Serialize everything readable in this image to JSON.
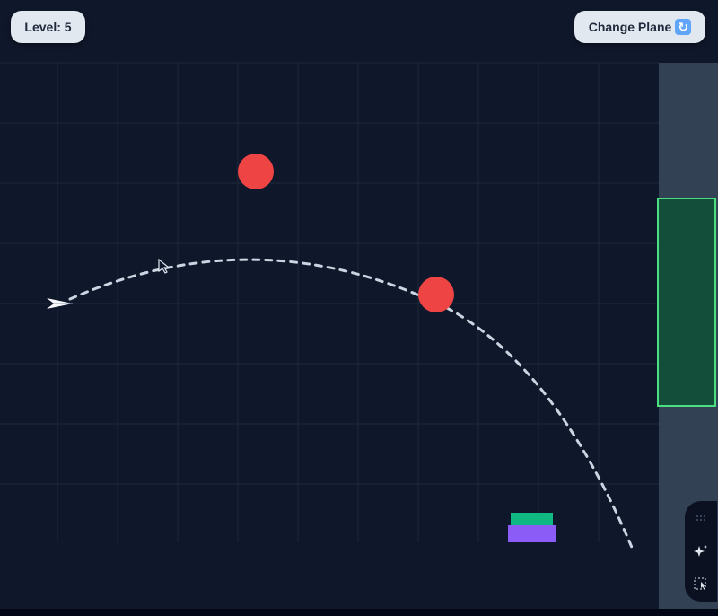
{
  "header": {
    "level_text": "Level: 5",
    "change_plane_label": "Change Plane"
  },
  "game": {
    "obstacles": [
      {
        "type": "red-ball",
        "color": "#ef4444"
      },
      {
        "type": "red-ball",
        "color": "#ef4444"
      }
    ],
    "target_zone": {
      "color": "#4ade80"
    },
    "launch_pad": {
      "top_color": "#10b981",
      "bottom_color": "#8b5cf6"
    },
    "trajectory": {
      "style": "dashed",
      "color": "#cbd5e1"
    }
  },
  "colors": {
    "background": "#0f172a",
    "grid": "#1e293b",
    "button_bg": "#e2e8f0",
    "button_text": "#1e293b",
    "wall": "#334155"
  },
  "tools": [
    "grip-icon",
    "sparkle-icon",
    "select-icon"
  ]
}
